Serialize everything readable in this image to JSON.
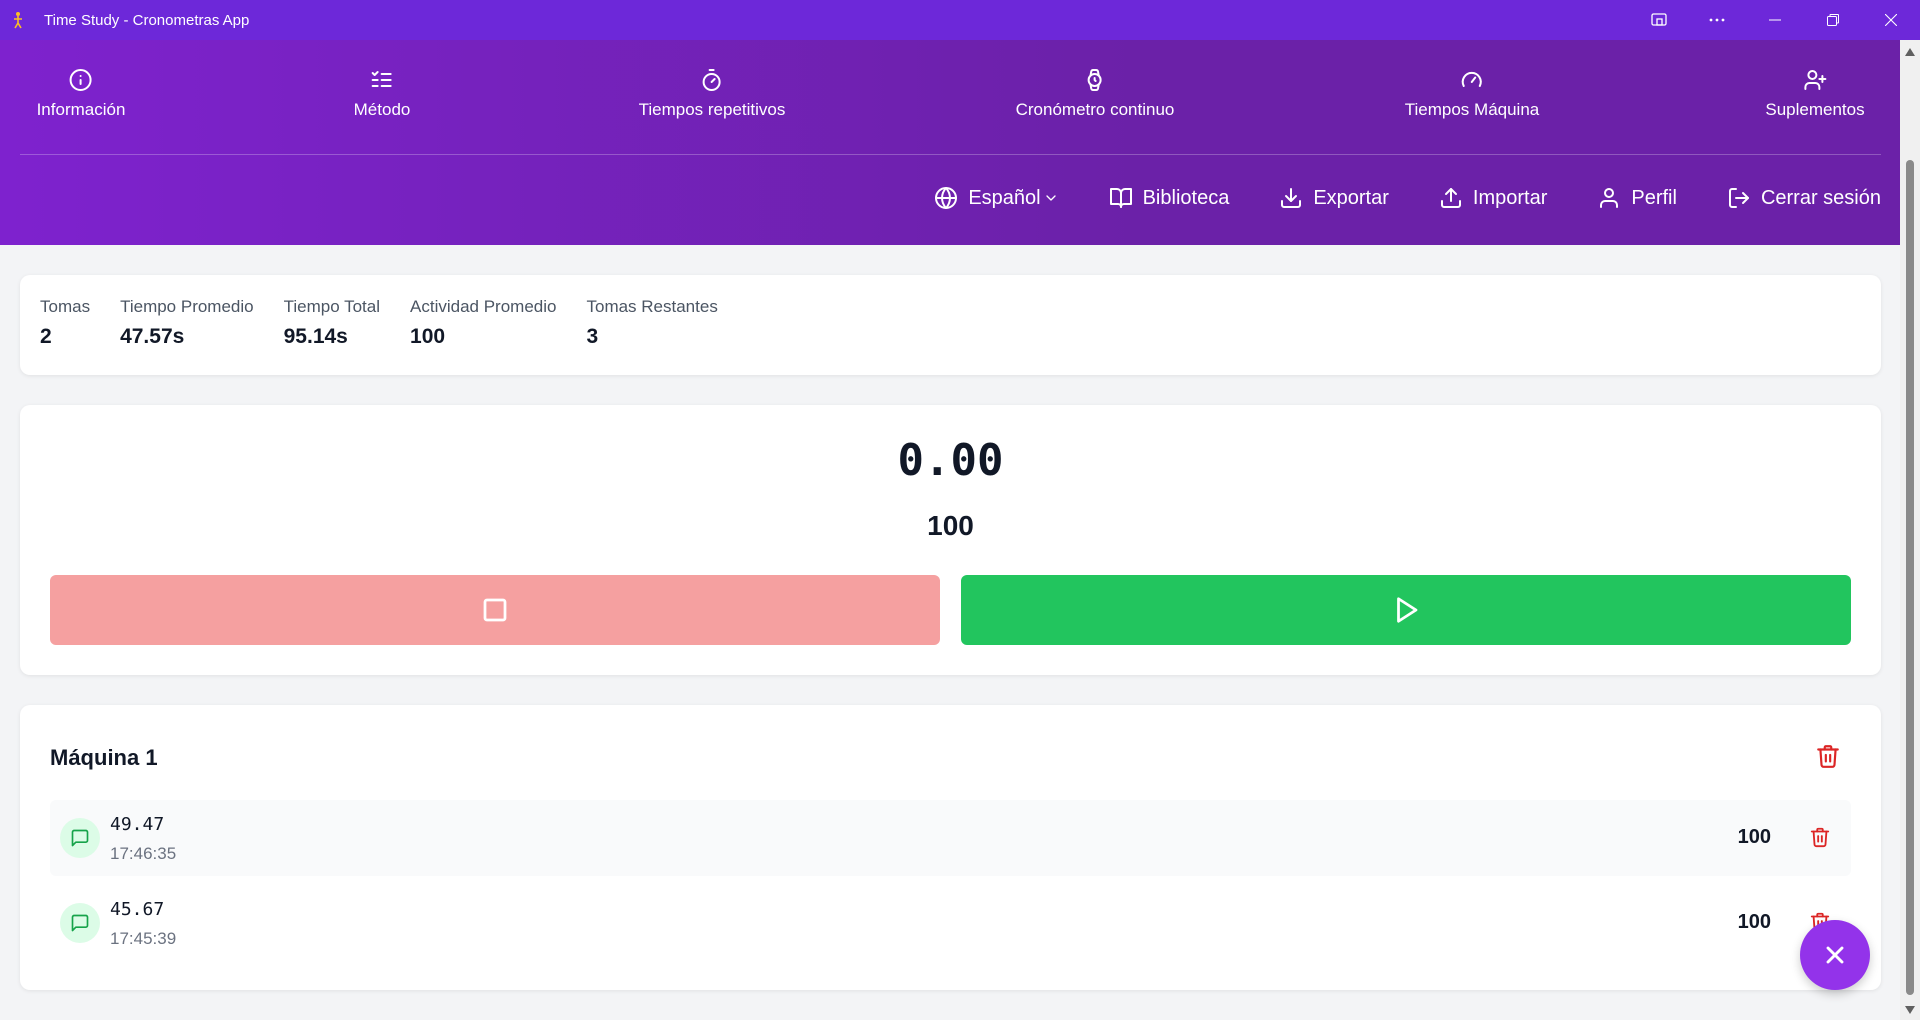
{
  "window": {
    "title": "Time Study - Cronometras App"
  },
  "nav": [
    {
      "label": "Información",
      "icon": "info-icon"
    },
    {
      "label": "Método",
      "icon": "list-checks-icon"
    },
    {
      "label": "Tiempos repetitivos",
      "icon": "timer-icon"
    },
    {
      "label": "Cronómetro continuo",
      "icon": "watch-icon"
    },
    {
      "label": "Tiempos Máquina",
      "icon": "gauge-icon"
    },
    {
      "label": "Suplementos",
      "icon": "user-plus-icon"
    }
  ],
  "actions": {
    "language": "Español",
    "library": "Biblioteca",
    "export": "Exportar",
    "import": "Importar",
    "profile": "Perfil",
    "logout": "Cerrar sesión"
  },
  "stats": [
    {
      "label": "Tomas",
      "value": "2"
    },
    {
      "label": "Tiempo Promedio",
      "value": "47.57s"
    },
    {
      "label": "Tiempo Total",
      "value": "95.14s"
    },
    {
      "label": "Actividad Promedio",
      "value": "100"
    },
    {
      "label": "Tomas Restantes",
      "value": "3"
    }
  ],
  "timer": {
    "time": "0.00",
    "activity": "100"
  },
  "machine": {
    "title": "Máquina 1",
    "records": [
      {
        "time": "49.47",
        "clock": "17:46:35",
        "activity": "100"
      },
      {
        "time": "45.67",
        "clock": "17:45:39",
        "activity": "100"
      }
    ]
  },
  "colors": {
    "header": "#7e22ce",
    "titlebar": "#6d28d9",
    "stop": "#f5a0a0",
    "play": "#22c55e",
    "fab": "#9333ea",
    "delete": "#dc2626"
  }
}
